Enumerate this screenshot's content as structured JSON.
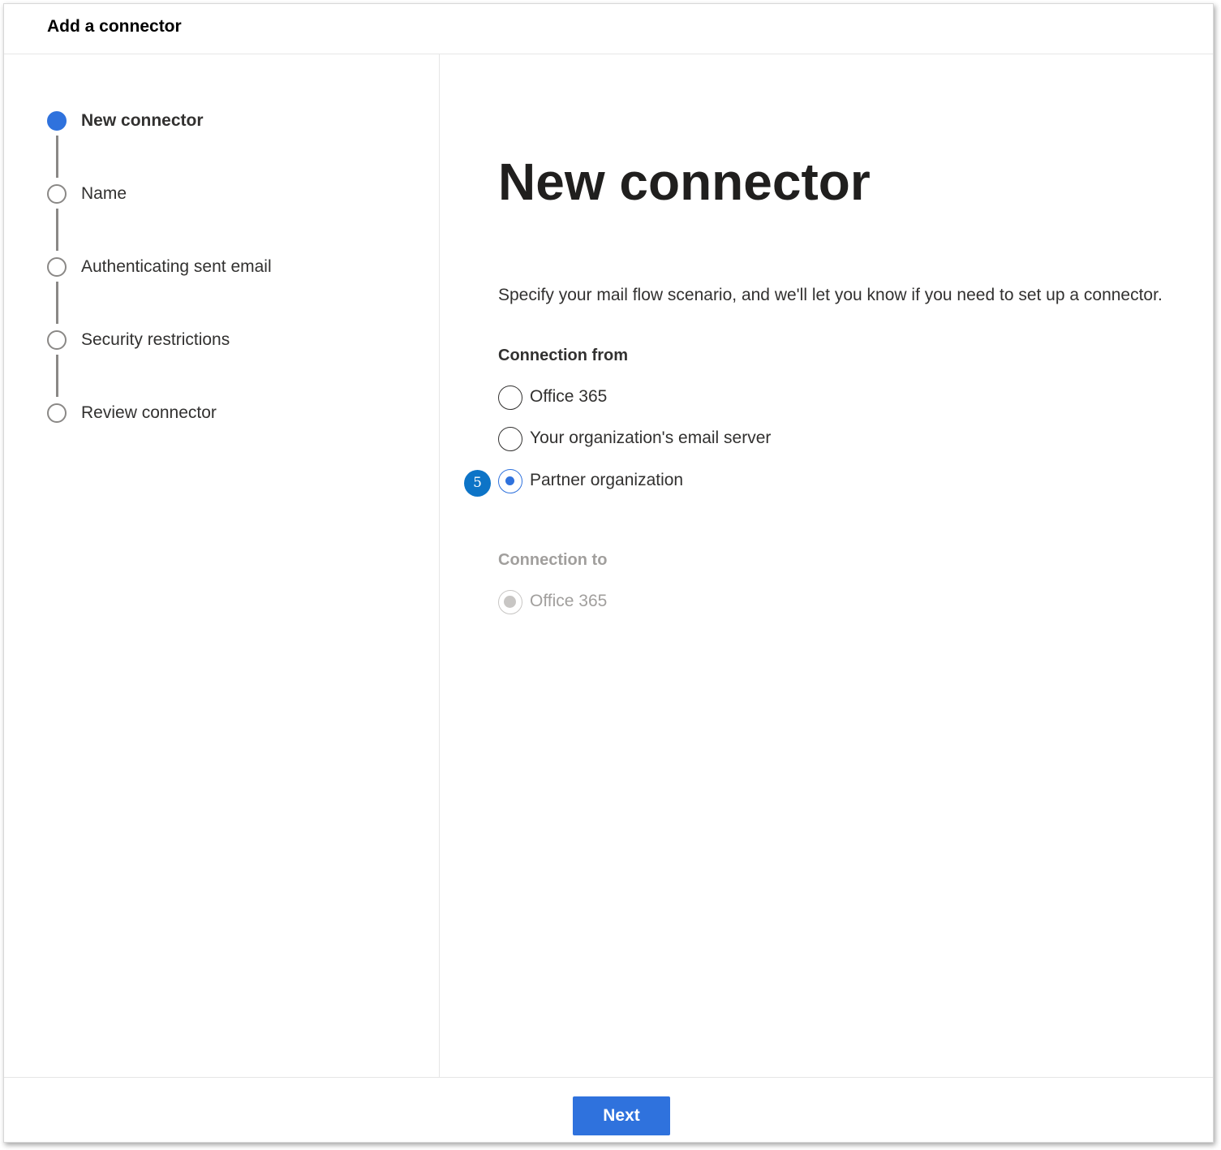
{
  "dialog": {
    "title": "Add a connector"
  },
  "steps": [
    {
      "label": "New connector",
      "state": "current"
    },
    {
      "label": "Name",
      "state": "pending"
    },
    {
      "label": "Authenticating sent email",
      "state": "pending"
    },
    {
      "label": "Security restrictions",
      "state": "pending"
    },
    {
      "label": "Review connector",
      "state": "pending"
    }
  ],
  "main": {
    "title": "New connector",
    "description": "Specify your mail flow scenario, and we'll let you know if you need to set up a connector.",
    "connection_from": {
      "label": "Connection from",
      "options": [
        {
          "label": "Office 365",
          "checked": false
        },
        {
          "label": "Your organization's email server",
          "checked": false
        },
        {
          "label": "Partner organization",
          "checked": true
        }
      ]
    },
    "callout": "5",
    "connection_to": {
      "label": "Connection to",
      "options": [
        {
          "label": "Office 365",
          "checked": true,
          "disabled": true
        }
      ]
    }
  },
  "footer": {
    "next_label": "Next"
  },
  "colors": {
    "accent": "#2f72dd",
    "callout": "#0d74c7",
    "disabled": "#a19f9d"
  }
}
